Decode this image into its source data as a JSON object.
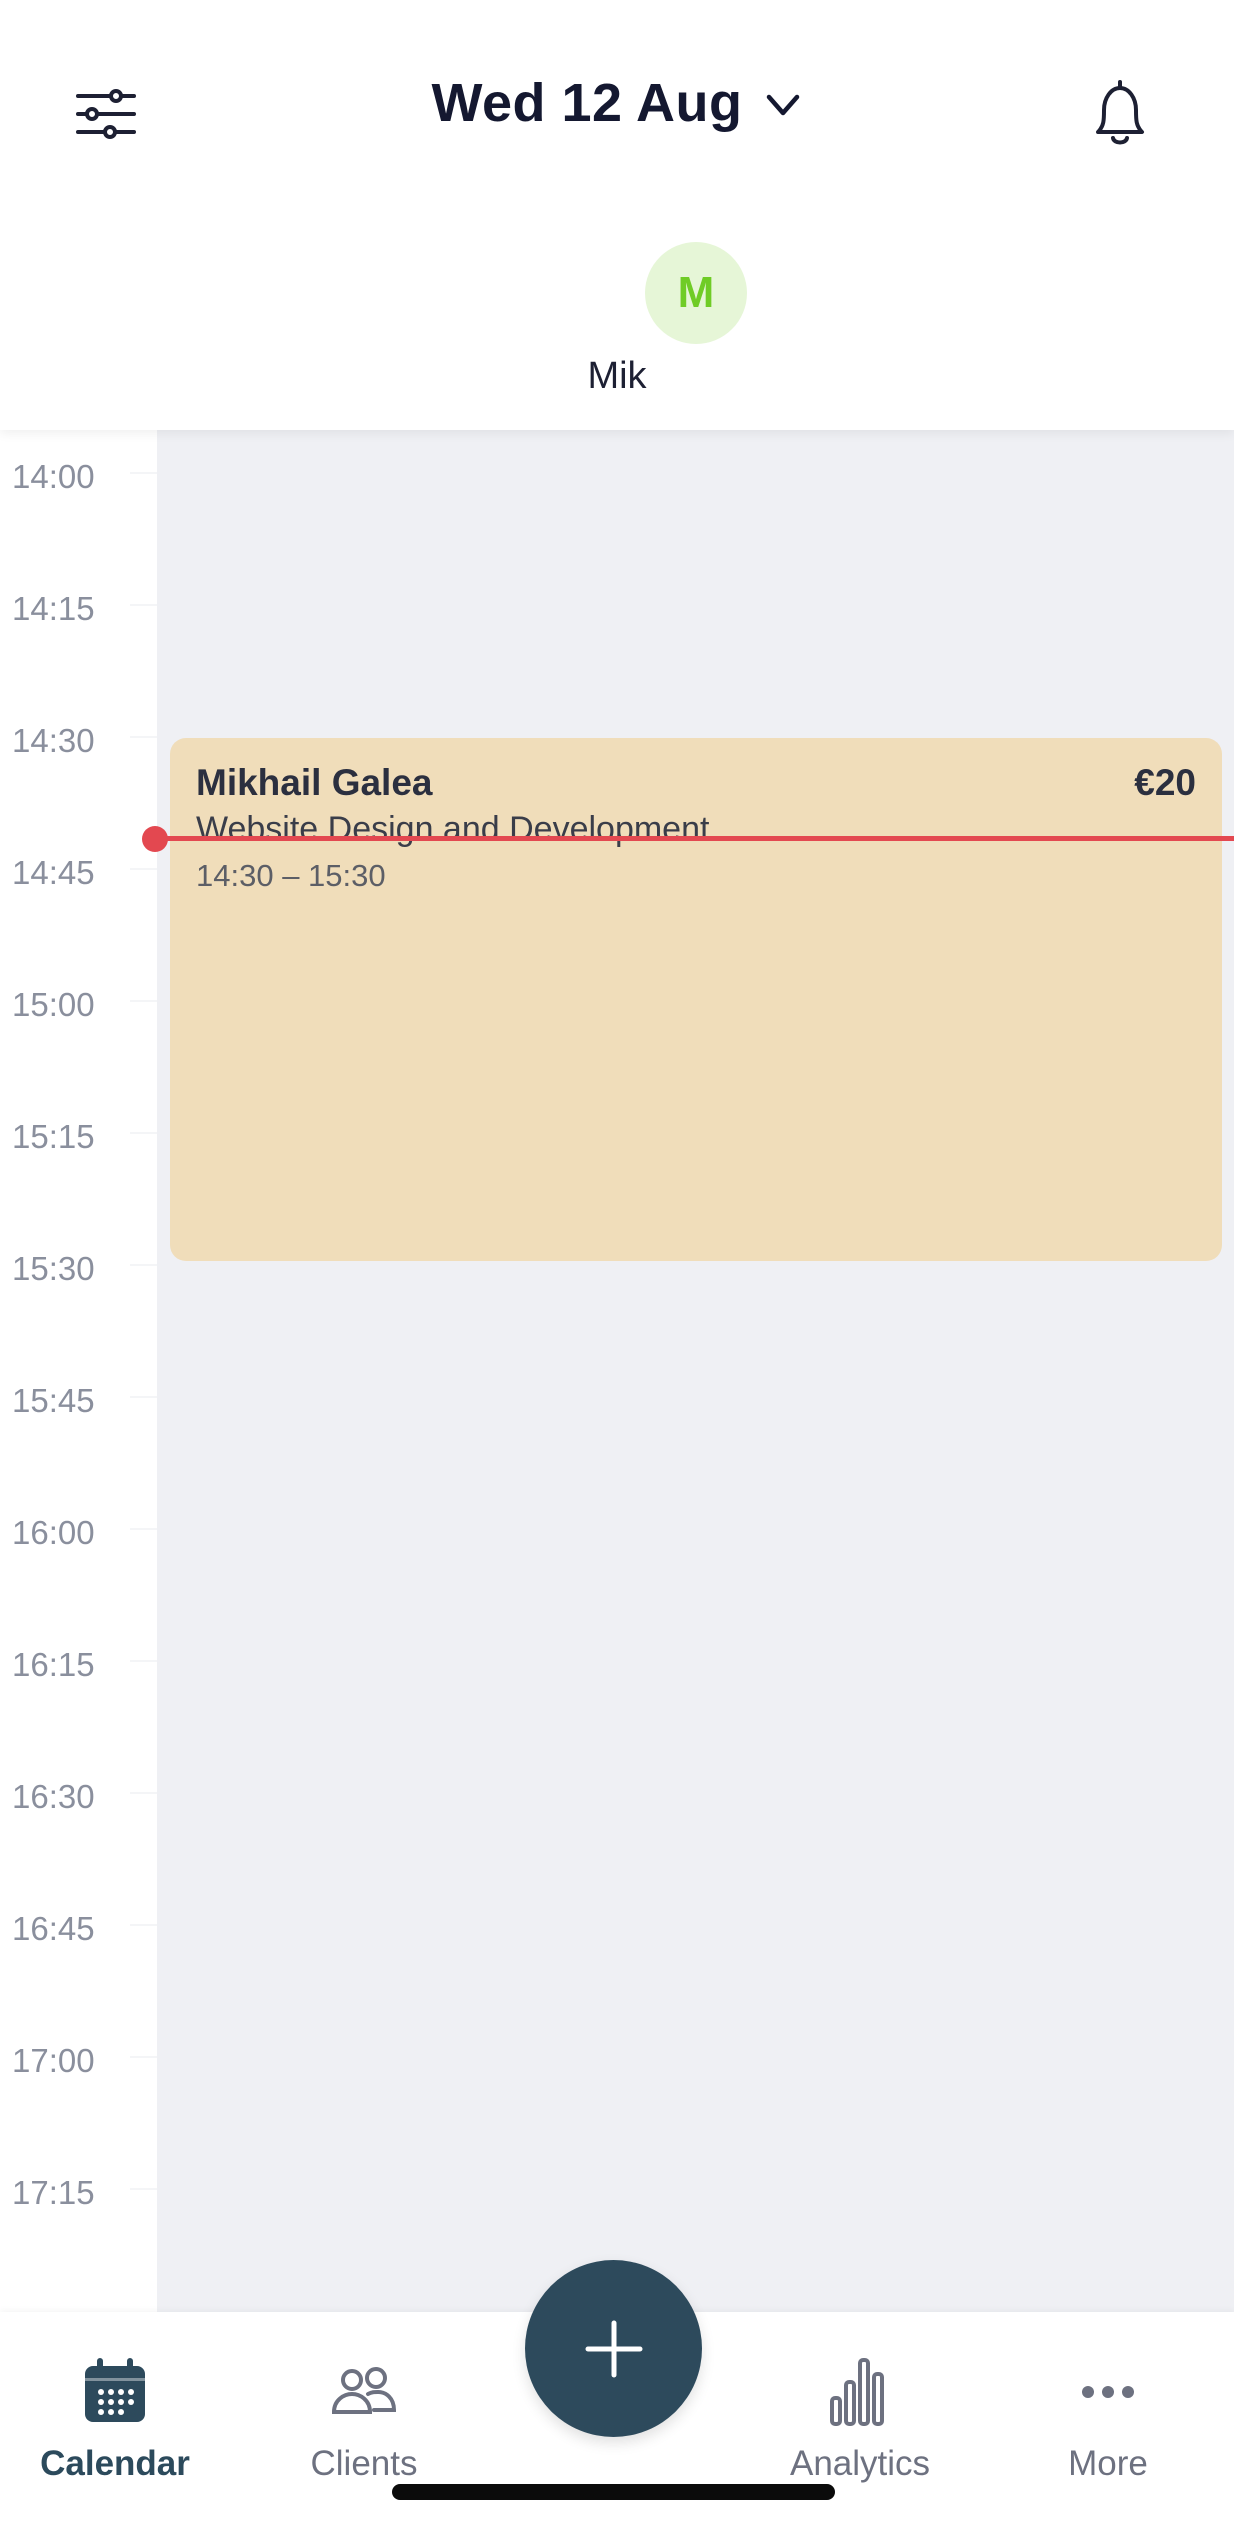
{
  "header": {
    "date": "Wed 12 Aug",
    "icons": {
      "filter": "sliders-icon",
      "notifications": "bell-icon",
      "date_picker": "chevron-down-icon"
    }
  },
  "staff": {
    "initial": "M",
    "name": "Mik",
    "avatar_bg": "#e6f6d7",
    "avatar_fg": "#6fcc26"
  },
  "timeline": {
    "slots": [
      "14:00",
      "14:15",
      "14:30",
      "14:45",
      "15:00",
      "15:15",
      "15:30",
      "15:45",
      "16:00",
      "16:15",
      "16:30",
      "16:45",
      "17:00",
      "17:15"
    ],
    "current_time_color": "#e34850"
  },
  "appointment": {
    "client": "Mikhail Galea",
    "price": "€20",
    "service": "Website Design and Development",
    "time": "14:30 – 15:30",
    "color": "#f0ddba"
  },
  "nav": {
    "tabs": [
      {
        "label": "Calendar",
        "icon": "calendar-icon",
        "active": true
      },
      {
        "label": "Clients",
        "icon": "clients-icon",
        "active": false
      },
      {
        "label": "Analytics",
        "icon": "analytics-icon",
        "active": false
      },
      {
        "label": "More",
        "icon": "more-icon",
        "active": false
      }
    ],
    "add_icon": "plus-icon",
    "accent": "#2d4a5c"
  }
}
